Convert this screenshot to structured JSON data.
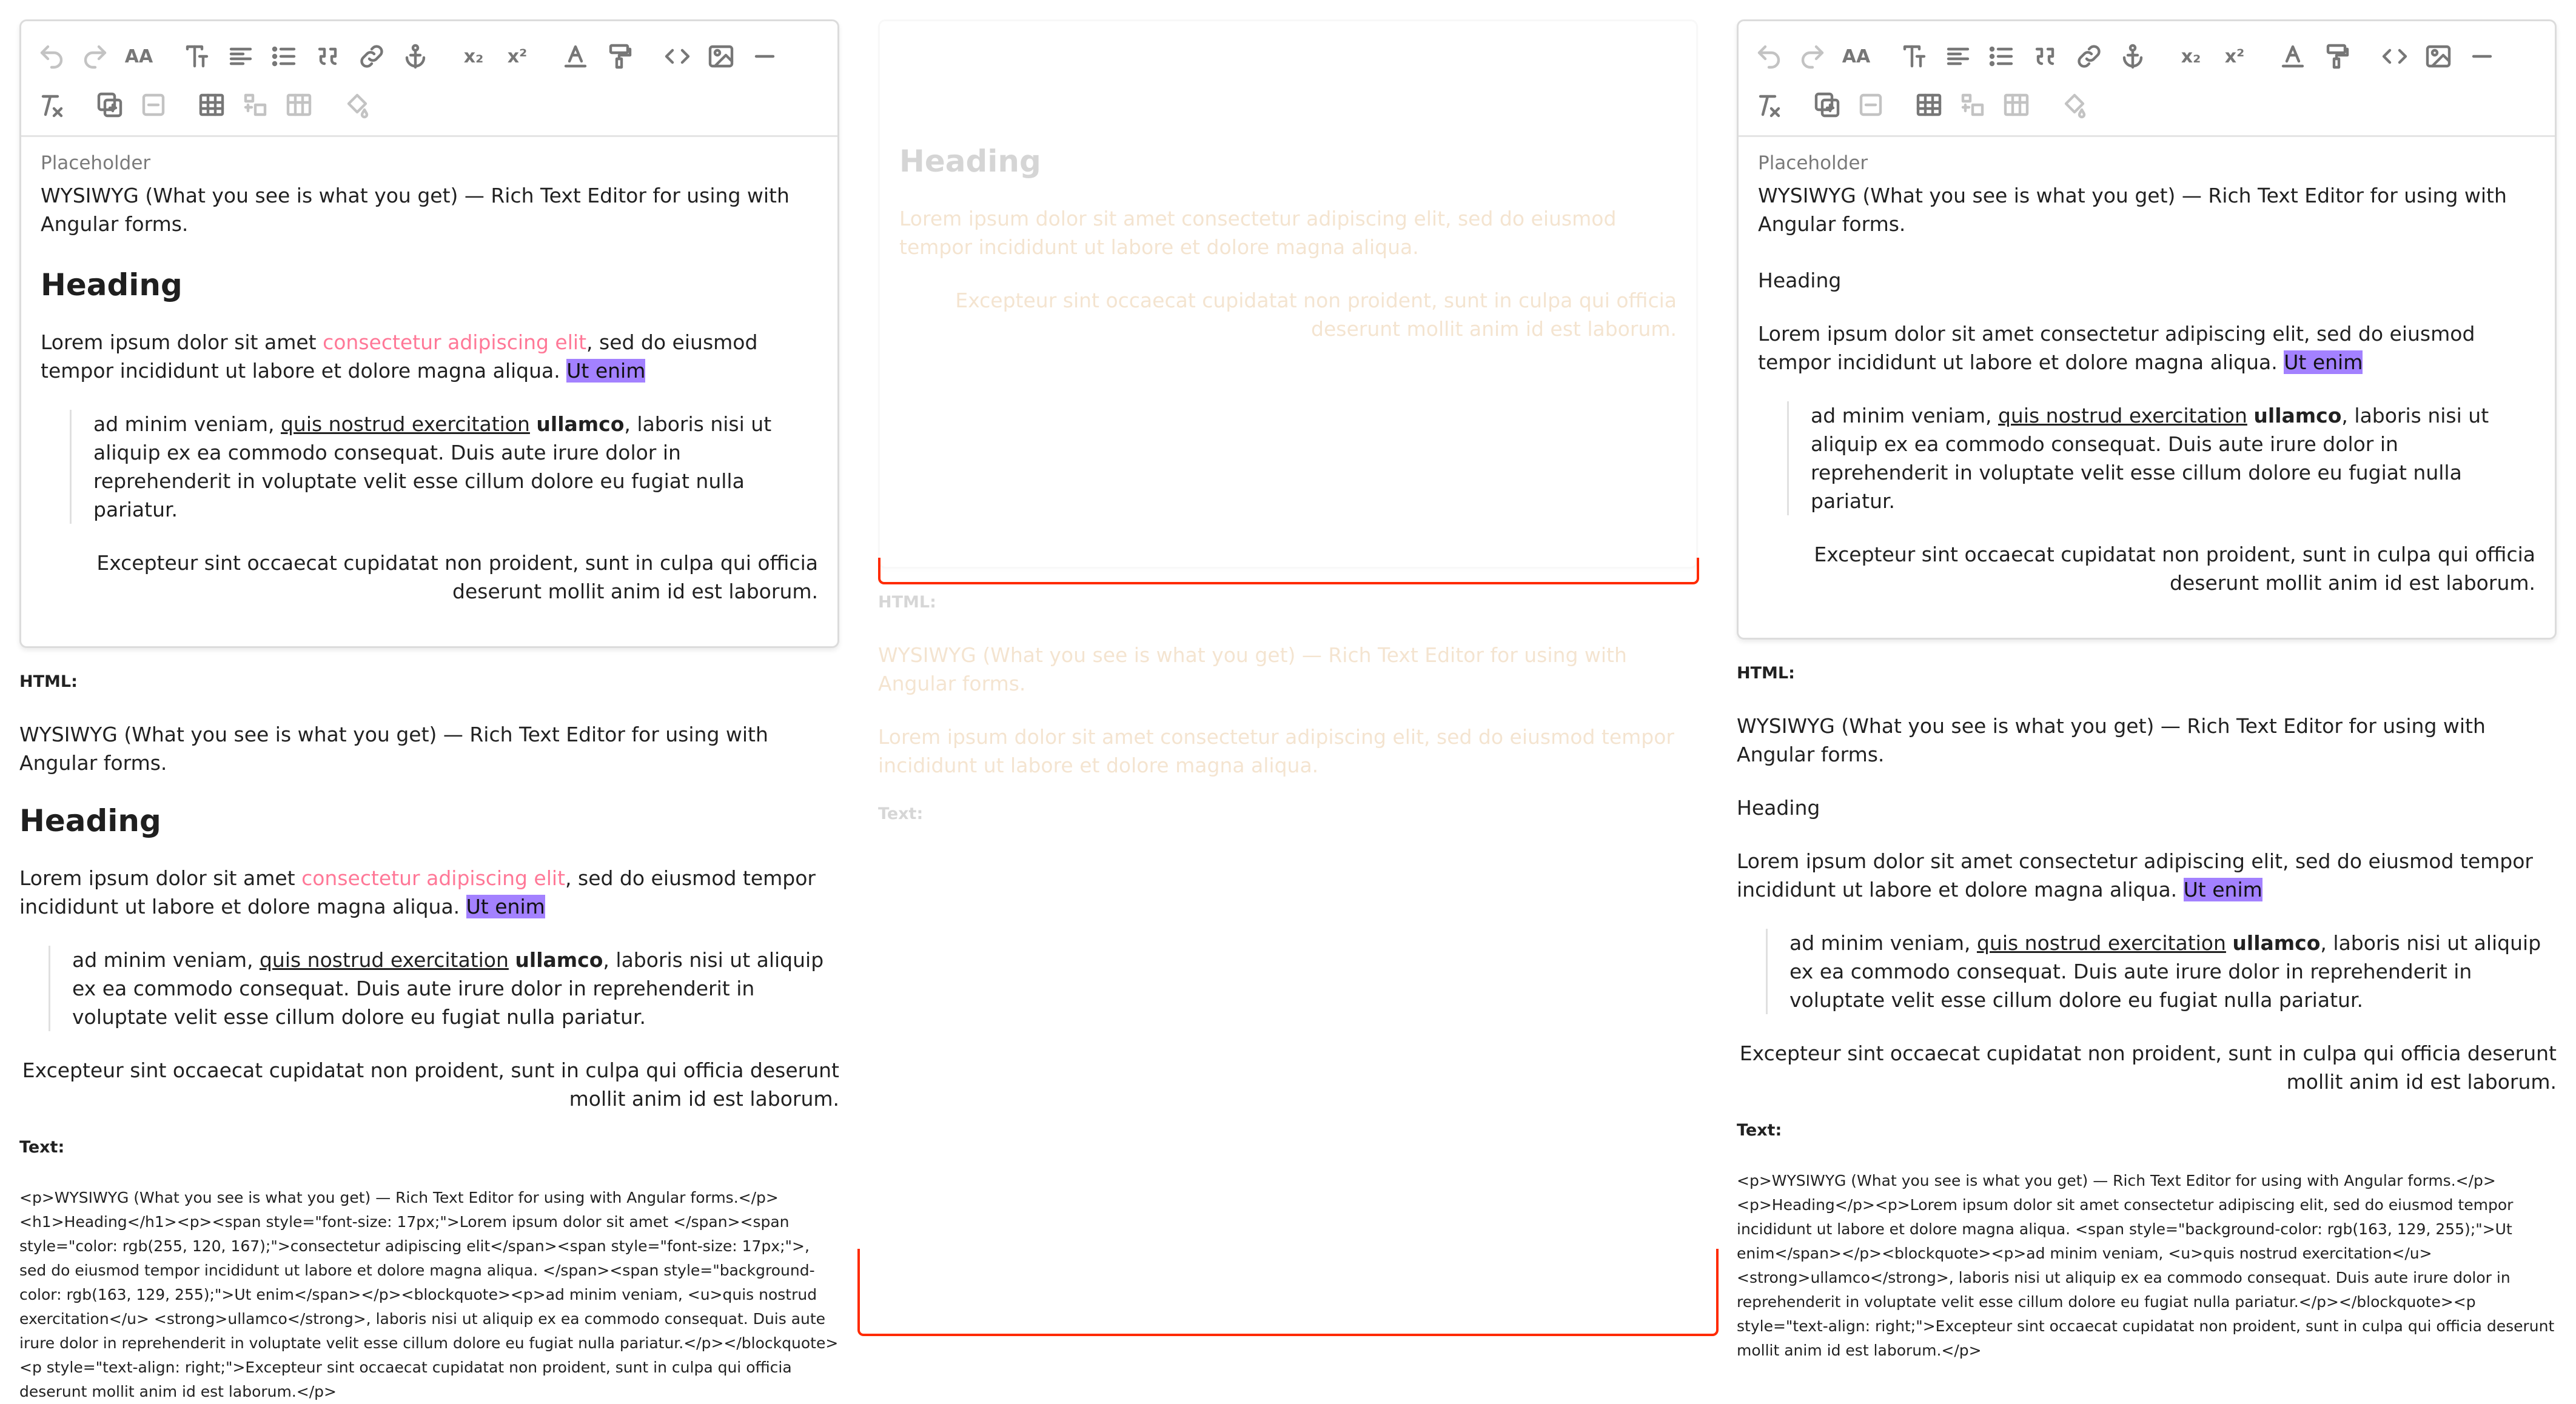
{
  "toolbar": {
    "row1": [
      "undo-icon",
      "redo-icon",
      "font-size-icon",
      "text-style-icon",
      "align-icon",
      "list-icon",
      "quote-icon",
      "link-icon",
      "anchor-icon",
      "subscript-icon",
      "superscript-icon",
      "text-color-icon",
      "paint-format-icon",
      "code-icon",
      "image-icon",
      "horizontal-rule-icon"
    ],
    "row2": [
      "clear-format-icon",
      "insert-column-icon",
      "delete-column-icon",
      "table-icon",
      "insert-row-icon",
      "delete-table-icon",
      "fill-color-icon"
    ]
  },
  "editor": {
    "placeholder": "Placeholder",
    "intro": "WYSIWYG (What you see is what you get) — Rich Text Editor for using with Angular forms.",
    "heading": "Heading",
    "para_start": "Lorem ipsum dolor sit amet ",
    "para_pink": "consectetur adipiscing elit",
    "para_rest": ", sed do eiusmod tempor incididunt ut labore et dolore magna aliqua. ",
    "para_plain": "Lorem ipsum dolor sit amet consectetur adipiscing elit, sed do eiusmod tempor incididunt ut labore et dolore magna aliqua. ",
    "para_hl": "Ut enim",
    "quote_start": "ad minim veniam, ",
    "quote_u": "quis nostrud exercitation",
    "quote_b": "ullamco",
    "quote_rest": ", laboris nisi ut aliquip ex ea commodo consequat. Duis aute irure dolor in reprehenderit in voluptate velit esse cillum dolore eu fugiat nulla pariatur.",
    "closing": "Excepteur sint occaecat cupidatat non proident, sunt in culpa qui officia deserunt mollit anim id est laborum."
  },
  "labels": {
    "html": "HTML:",
    "text": "Text:"
  },
  "raw_left": "<p>WYSIWYG (What you see is what you get) — Rich Text Editor for using with Angular forms.</p><h1>Heading</h1><p><span style=\"font-size: 17px;\">Lorem ipsum dolor sit amet </span><span style=\"color: rgb(255, 120, 167);\">consectetur adipiscing elit</span><span style=\"font-size: 17px;\">, sed do eiusmod tempor incididunt ut labore et dolore magna aliqua. </span><span style=\"background-color: rgb(163, 129, 255);\">Ut enim</span></p><blockquote><p>ad minim veniam, <u>quis nostrud exercitation</u> <strong>ullamco</strong>, laboris nisi ut aliquip ex ea commodo consequat. Duis aute irure dolor in reprehenderit in voluptate velit esse cillum dolore eu fugiat nulla pariatur.</p></blockquote><p style=\"text-align: right;\">Excepteur sint occaecat cupidatat non proident, sunt in culpa qui officia deserunt mollit anim id est laborum.</p>",
  "raw_right": "<p>WYSIWYG (What you see is what you get) — Rich Text Editor for using with Angular forms.</p><p>Heading</p><p>Lorem ipsum dolor sit amet consectetur adipiscing elit, sed do eiusmod tempor incididunt ut labore et dolore magna aliqua. <span style=\"background-color: rgb(163, 129, 255);\">Ut enim</span></p><blockquote><p>ad minim veniam, <u>quis nostrud exercitation</u> <strong>ullamco</strong>, laboris nisi ut aliquip ex ea commodo consequat. Duis aute irure dolor in reprehenderit in voluptate velit esse cillum dolore eu fugiat nulla pariatur.</p></blockquote><p style=\"text-align: right;\">Excepteur sint occaecat cupidatat non proident, sunt in culpa qui officia deserunt mollit anim id est laborum.</p>"
}
